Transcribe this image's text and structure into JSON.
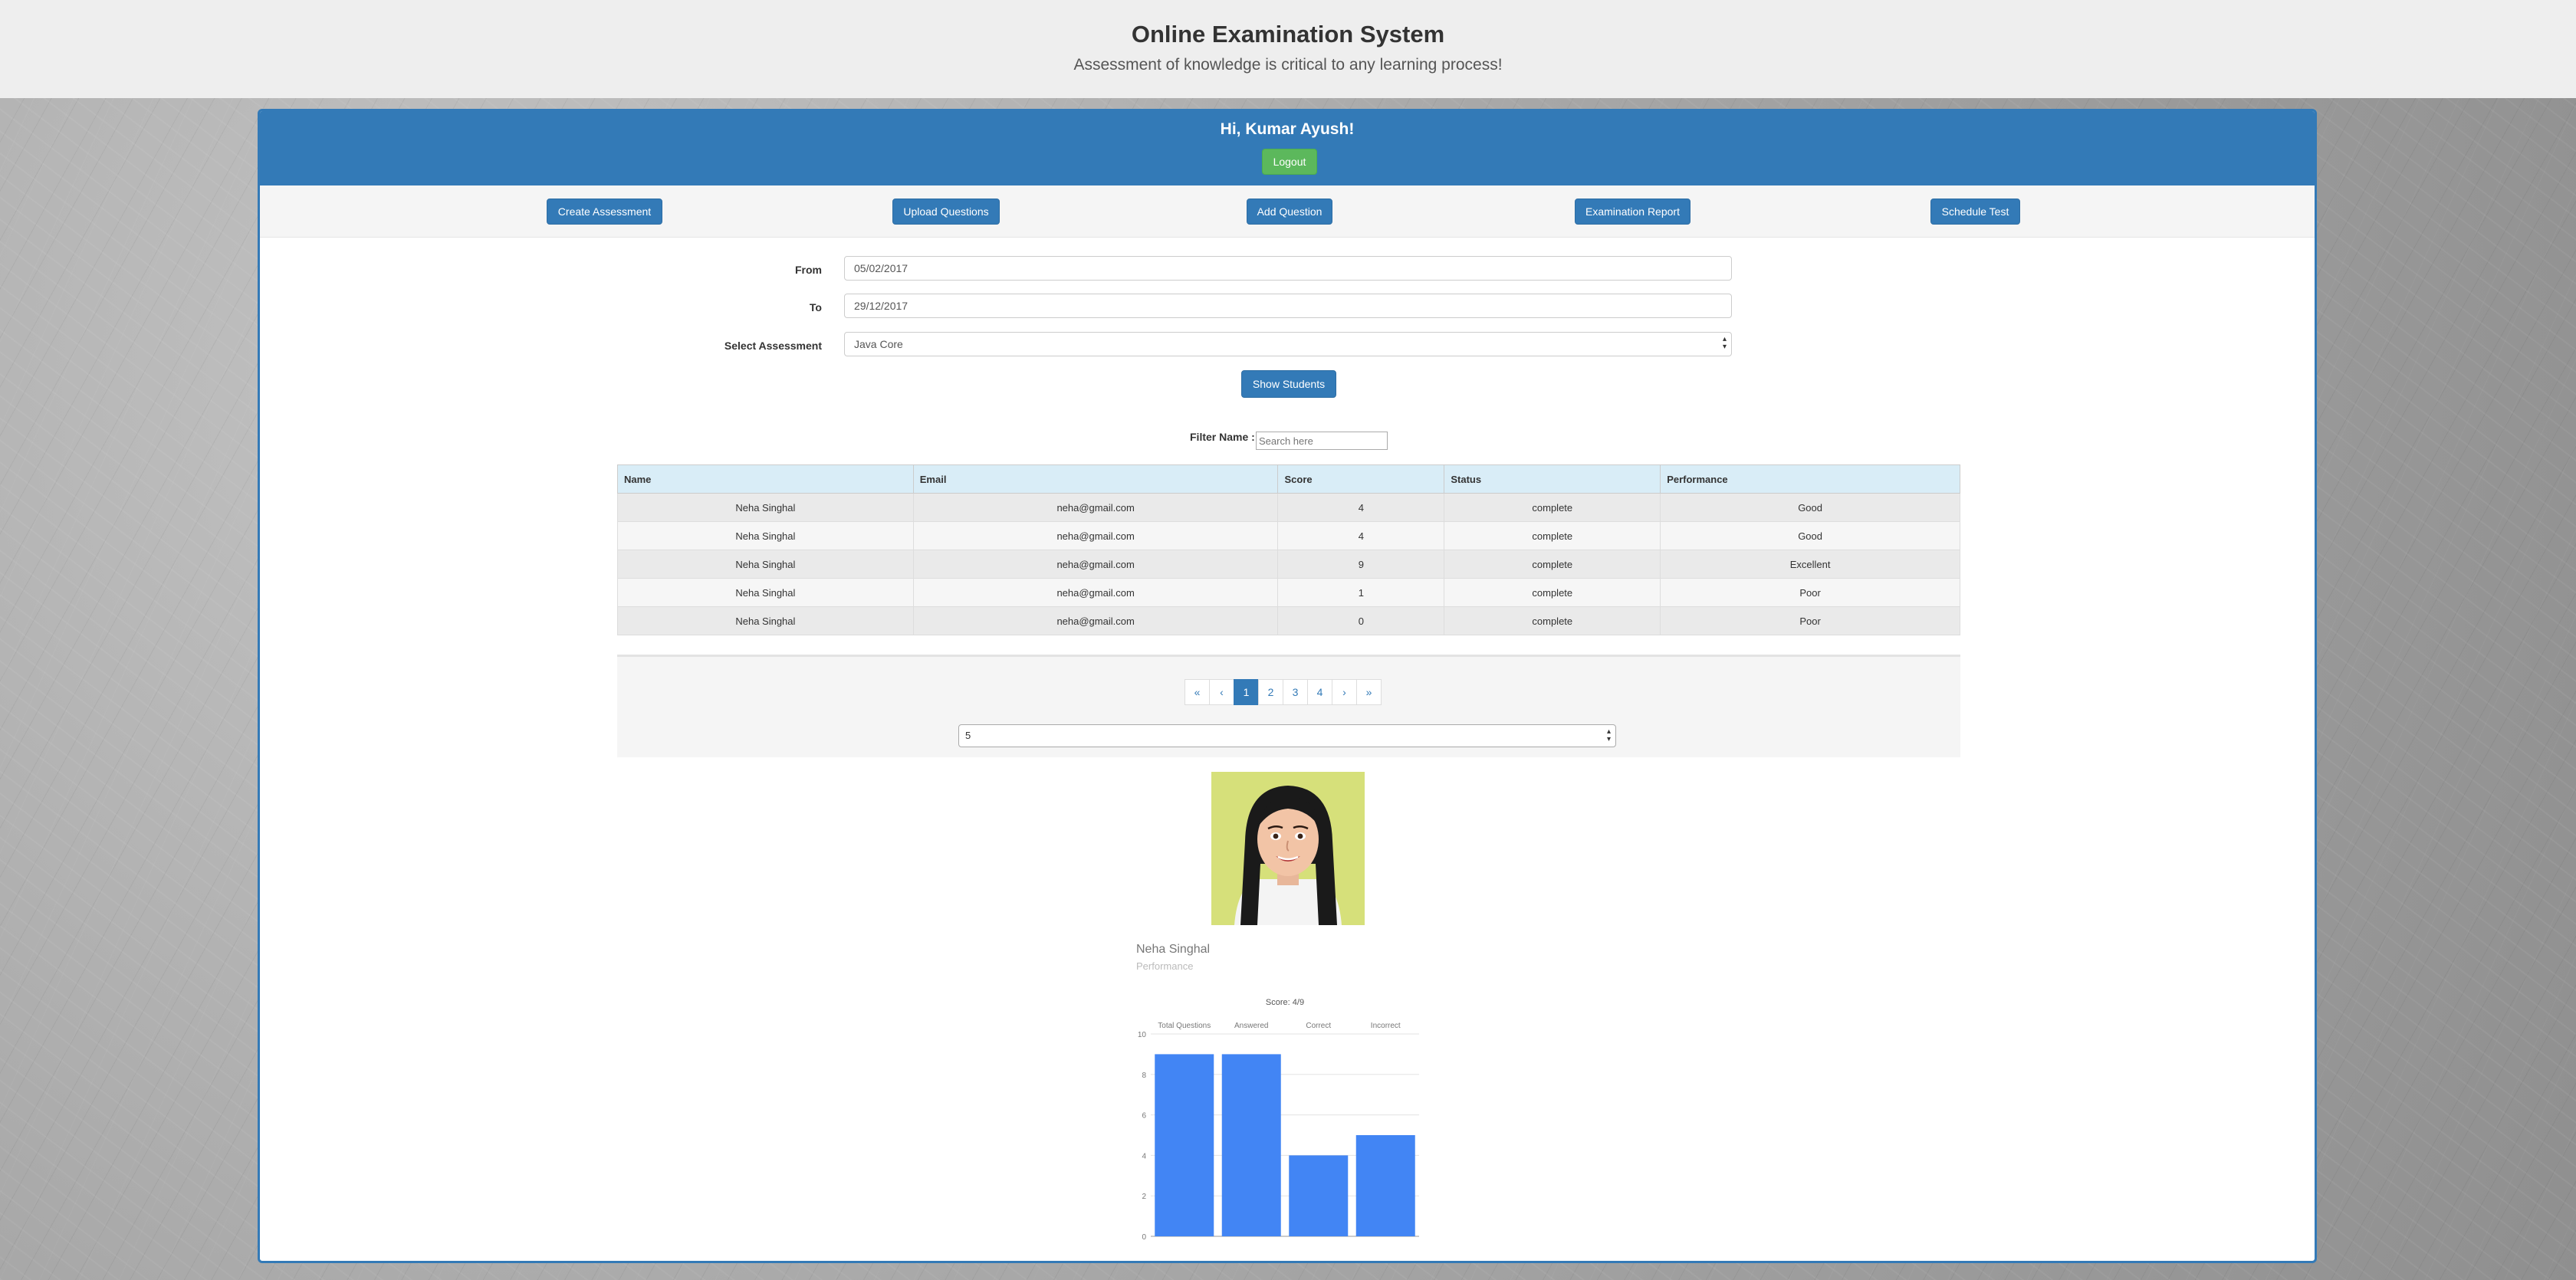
{
  "header": {
    "title": "Online Examination System",
    "subtitle": "Assessment of knowledge is critical to any learning process!"
  },
  "panel": {
    "greeting": "Hi, Kumar Ayush!",
    "logout_label": "Logout"
  },
  "nav": {
    "create": "Create Assessment",
    "upload": "Upload Questions",
    "add": "Add Question",
    "report": "Examination Report",
    "schedule": "Schedule Test"
  },
  "form": {
    "from_label": "From",
    "from_value": "05/02/2017",
    "to_label": "To",
    "to_value": "29/12/2017",
    "assessment_label": "Select Assessment",
    "assessment_value": "Java Core",
    "show_label": "Show Students"
  },
  "filter": {
    "label": "Filter Name :",
    "placeholder": "Search here"
  },
  "table": {
    "headers": [
      "Name",
      "Email",
      "Score",
      "Status",
      "Performance"
    ],
    "rows": [
      [
        "Neha Singhal",
        "neha@gmail.com",
        "4",
        "complete",
        "Good"
      ],
      [
        "Neha Singhal",
        "neha@gmail.com",
        "4",
        "complete",
        "Good"
      ],
      [
        "Neha Singhal",
        "neha@gmail.com",
        "9",
        "complete",
        "Excellent"
      ],
      [
        "Neha Singhal",
        "neha@gmail.com",
        "1",
        "complete",
        "Poor"
      ],
      [
        "Neha Singhal",
        "neha@gmail.com",
        "0",
        "complete",
        "Poor"
      ]
    ]
  },
  "pagination": {
    "first": "«",
    "prev": "‹",
    "pages": [
      "1",
      "2",
      "3",
      "4"
    ],
    "active_page": "1",
    "next": "›",
    "last": "»",
    "page_size": "5"
  },
  "profile": {
    "name": "Neha Singhal",
    "subtitle": "Performance"
  },
  "colors": {
    "primary": "#337ab7",
    "success": "#5cb85c",
    "bar": "#4285f4"
  },
  "chart_data": {
    "type": "bar",
    "title": "Score: 4/9",
    "categories": [
      "Total Questions",
      "Answered",
      "Correct",
      "Incorrect"
    ],
    "values": [
      9,
      9,
      4,
      5
    ],
    "ylim": [
      0,
      10
    ],
    "yticks": [
      0,
      2,
      4,
      6,
      8,
      10
    ],
    "xlabel": "",
    "ylabel": "",
    "grid": true,
    "legend": "none",
    "category_labels_position": "top"
  }
}
